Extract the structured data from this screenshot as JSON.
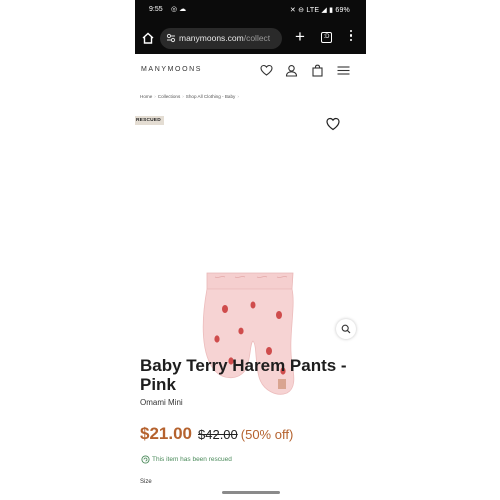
{
  "status_bar": {
    "time": "9:55",
    "left_icons": [
      "instagram-icon",
      "cloud-icon"
    ],
    "right_text": "LTE",
    "battery": "69%"
  },
  "browser": {
    "url_host": "manymoons.com",
    "url_path": "/collect",
    "plus_label": "+",
    "tabs_count": ":D"
  },
  "site": {
    "logo": "MANYMOONS"
  },
  "breadcrumb": [
    "Home",
    "Collections",
    "Shop All Clothing - Baby"
  ],
  "product": {
    "badge": "RESCUED",
    "title": "Baby Terry Harem Pants - Pink",
    "brand": "Omami Mini",
    "price": "$21.00",
    "original_price": "$42.00",
    "discount": "(50% off)",
    "rescued_note": "This item has been rescued",
    "size_label": "Size"
  },
  "colors": {
    "accent_price": "#b5622e",
    "rescued_green": "#4a8a5a",
    "badge_bg": "#e4ddd3",
    "product_pink": "#f6d3d3"
  }
}
